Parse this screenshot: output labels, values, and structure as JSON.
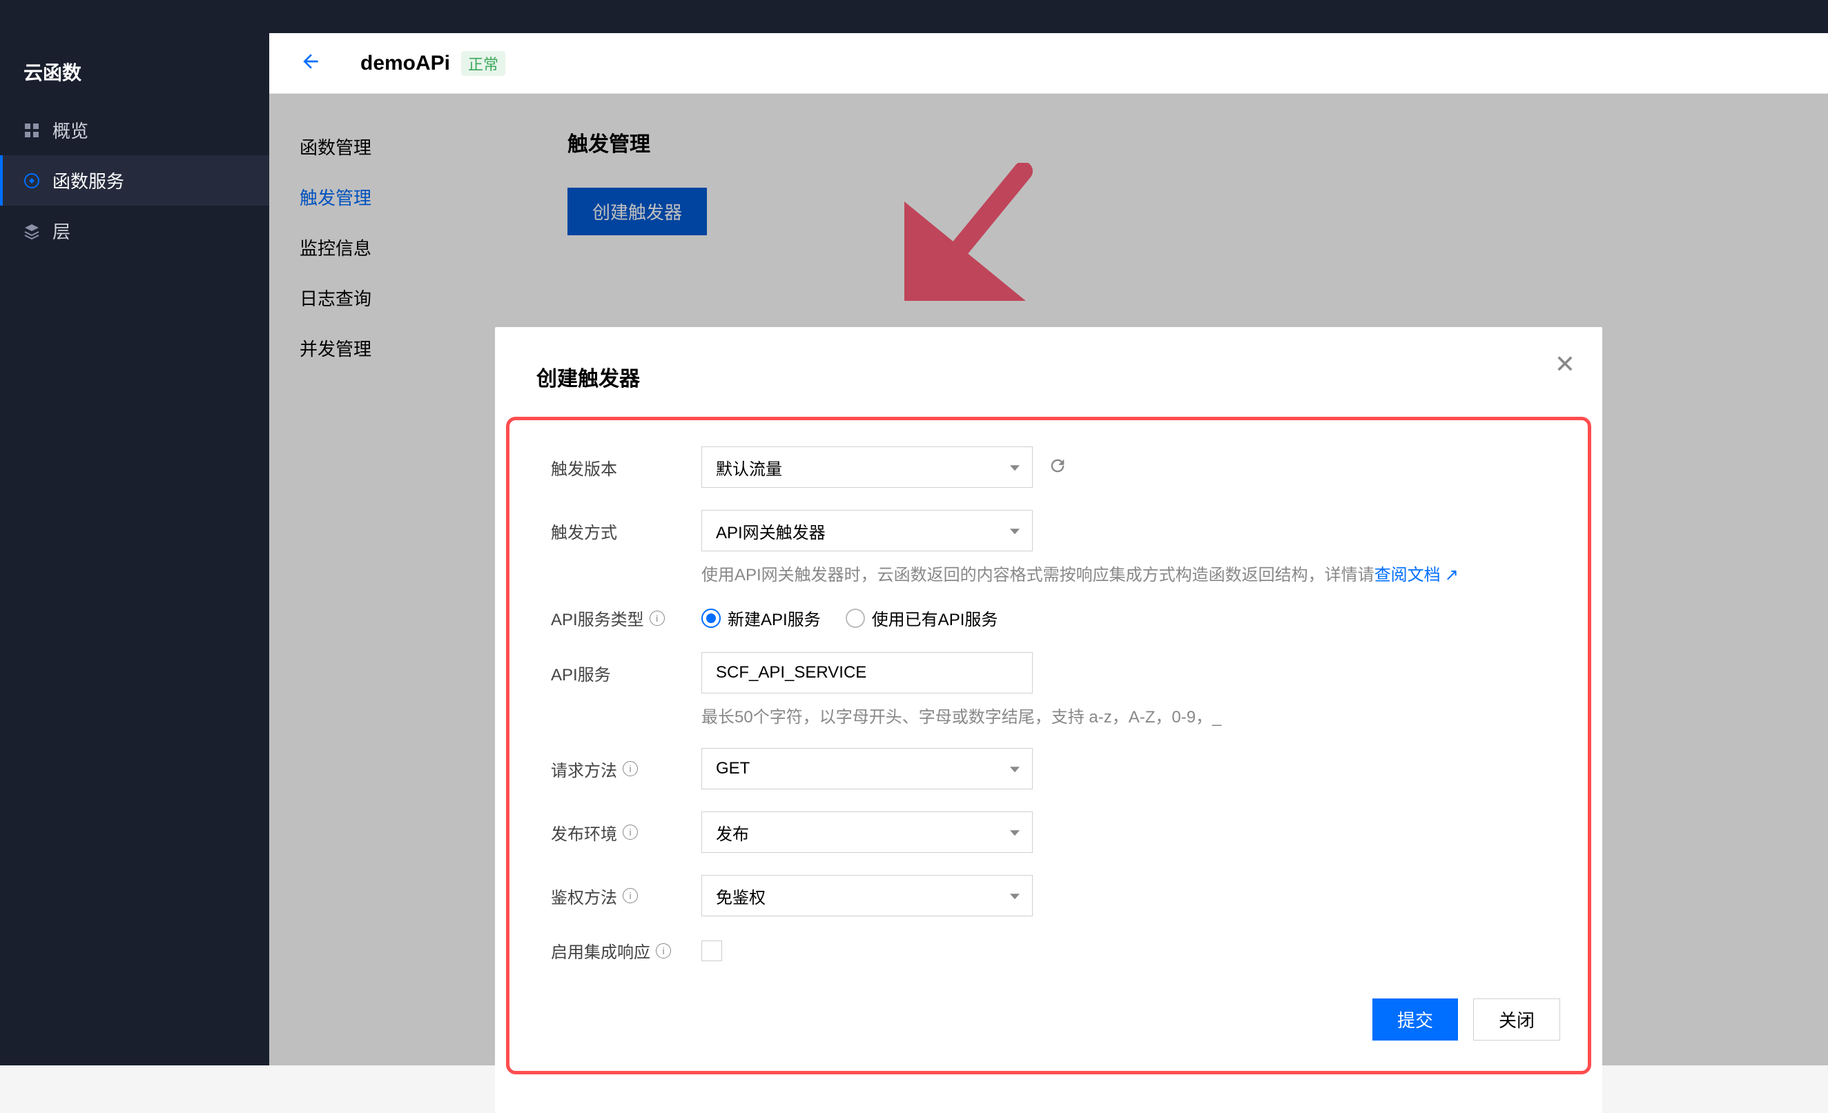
{
  "sidebar": {
    "title": "云函数",
    "items": [
      {
        "label": "概览"
      },
      {
        "label": "函数服务"
      },
      {
        "label": "层"
      }
    ]
  },
  "header": {
    "app_name": "demoAPi",
    "status": "正常"
  },
  "subnav": {
    "items": [
      {
        "label": "函数管理"
      },
      {
        "label": "触发管理"
      },
      {
        "label": "监控信息"
      },
      {
        "label": "日志查询"
      },
      {
        "label": "并发管理"
      }
    ]
  },
  "panel": {
    "title": "触发管理",
    "create_btn": "创建触发器"
  },
  "modal": {
    "title": "创建触发器",
    "labels": {
      "version": "触发版本",
      "method": "触发方式",
      "service_type": "API服务类型",
      "service": "API服务",
      "request": "请求方法",
      "env": "发布环境",
      "auth": "鉴权方法",
      "integrated": "启用集成响应"
    },
    "values": {
      "version": "默认流量",
      "method": "API网关触发器",
      "service": "SCF_API_SERVICE",
      "request": "GET",
      "env": "发布",
      "auth": "免鉴权"
    },
    "radio": {
      "new_service": "新建API服务",
      "existing_service": "使用已有API服务"
    },
    "hints": {
      "method_prefix": "使用API网关触发器时，云函数返回的内容格式需按响应集成方式构造函数返回结构，详情请",
      "method_link": "查阅文档",
      "service": "最长50个字符，以字母开头、字母或数字结尾，支持 a-z，A-Z，0-9，_"
    },
    "footer": {
      "submit": "提交",
      "close": "关闭"
    }
  }
}
